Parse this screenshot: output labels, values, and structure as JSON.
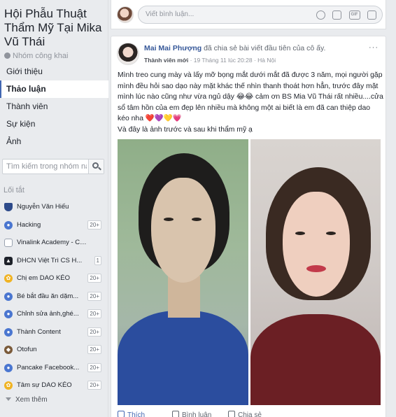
{
  "group": {
    "title": "Hội Phẫu Thuật Thẩm Mỹ Tại Mika Vũ Thái",
    "privacy": "Nhóm công khai"
  },
  "nav": {
    "items": [
      {
        "label": "Giới thiệu",
        "active": false
      },
      {
        "label": "Thảo luận",
        "active": true
      },
      {
        "label": "Thành viên",
        "active": false
      },
      {
        "label": "Sự kiện",
        "active": false
      },
      {
        "label": "Ảnh",
        "active": false
      }
    ]
  },
  "search": {
    "placeholder": "Tìm kiếm trong nhóm này"
  },
  "shortcuts": {
    "header": "Lối tắt",
    "items": [
      {
        "label": "Nguyễn Văn Hiếu",
        "badge": "",
        "icon": "shield-icon",
        "color": "#2d4a8a"
      },
      {
        "label": "Hacking",
        "badge": "20+",
        "icon": "group-icon",
        "color": "#4a76d0"
      },
      {
        "label": "Vinalink Academy - Con...",
        "badge": "",
        "icon": "page-icon",
        "color": "#9aa3b0"
      },
      {
        "label": "ĐHCN Việt Trì CS H...",
        "badge": "1",
        "icon": "graduation-cap-icon",
        "color": "#1d2129"
      },
      {
        "label": "Chị em DAO KÉO",
        "badge": "20+",
        "icon": "flower-icon",
        "color": "#f0b323"
      },
      {
        "label": "Bé bắt đầu ăn dặm...",
        "badge": "20+",
        "icon": "group-icon",
        "color": "#4a76d0"
      },
      {
        "label": "Chỉnh sửa ảnh,ghé...",
        "badge": "20+",
        "icon": "group-icon",
        "color": "#4a76d0"
      },
      {
        "label": "Thành Content",
        "badge": "20+",
        "icon": "group-icon",
        "color": "#4a76d0"
      },
      {
        "label": "Otofun",
        "badge": "20+",
        "icon": "dog-icon",
        "color": "#7a5a3a"
      },
      {
        "label": "Pancake Facebook...",
        "badge": "20+",
        "icon": "group-icon",
        "color": "#4a76d0"
      },
      {
        "label": "Tâm sự DAO KÉO",
        "badge": "20+",
        "icon": "flower-icon",
        "color": "#f0b323"
      }
    ],
    "see_more": "Xem thêm"
  },
  "comment_bar": {
    "placeholder": "Viết bình luận..."
  },
  "post": {
    "author": "Mai Mai Phượng",
    "action_text": "đã chia sẻ bài viết đầu tiên của cô ấy.",
    "role": "Thành viên mới",
    "time": "· 19 Tháng 11 lúc 20:28 · Hà Nội",
    "more": "···",
    "text_lines": [
      "Mình treo cung mày và lấy mỡ bọng mắt dưới mắt đã được 3 năm, mọi người gặp mình đều hỏi sao dạo này mặt khác thế nhìn thanh thoát hơn hẳn, trước đây mặt mình lúc nào cũng như vừa ngủ dậy 😂😂 cảm ơn BS Mia Vũ Thái rất nhiều....cửa sổ tâm hồn của em đẹp lên nhiều mà không một ai biết là em đã can thiệp dao kéo nha ❤️💜💛💗",
      "Và đây là ảnh trước và sau khi thẩm mỹ ạ"
    ],
    "actions": {
      "like": "Thích",
      "comment": "Bình luận",
      "share": "Chia sẻ"
    }
  },
  "colors": {
    "accent": "#4267b2",
    "link": "#365899",
    "background": "#e9ebee"
  }
}
